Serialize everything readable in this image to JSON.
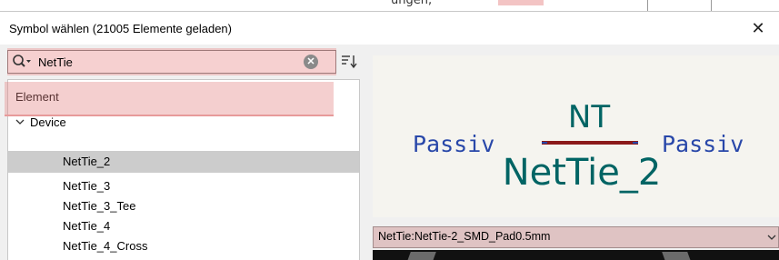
{
  "window": {
    "title": "Symbol wählen (21005 Elemente geladen)",
    "close_label": "✕"
  },
  "background_peek": {
    "text": "ungen, "
  },
  "search": {
    "value": "NetTie",
    "clear_label": "✕",
    "icon": "search-with-dropdown-icon"
  },
  "sort_button": {
    "icon": "sort-alpha-icon"
  },
  "tree": {
    "header": "Element",
    "library": "Device",
    "items": [
      {
        "label": "NetTie_2",
        "selected": true
      },
      {
        "label": "NetTie_3",
        "selected": false
      },
      {
        "label": "NetTie_3_Tee",
        "selected": false
      },
      {
        "label": "NetTie_4",
        "selected": false
      },
      {
        "label": "NetTie_4_Cross",
        "selected": false
      }
    ]
  },
  "symbol_preview": {
    "reference": "NT",
    "value": "NetTie_2",
    "pin_left": "Passiv",
    "pin_right": "Passiv",
    "colors": {
      "background": "#f5f4ef",
      "reference": "#006464",
      "pin_type": "#2847a9",
      "body": "#8b1a1a"
    }
  },
  "footprint": {
    "selected": "NetTie:NetTie-2_SMD_Pad0.5mm"
  }
}
